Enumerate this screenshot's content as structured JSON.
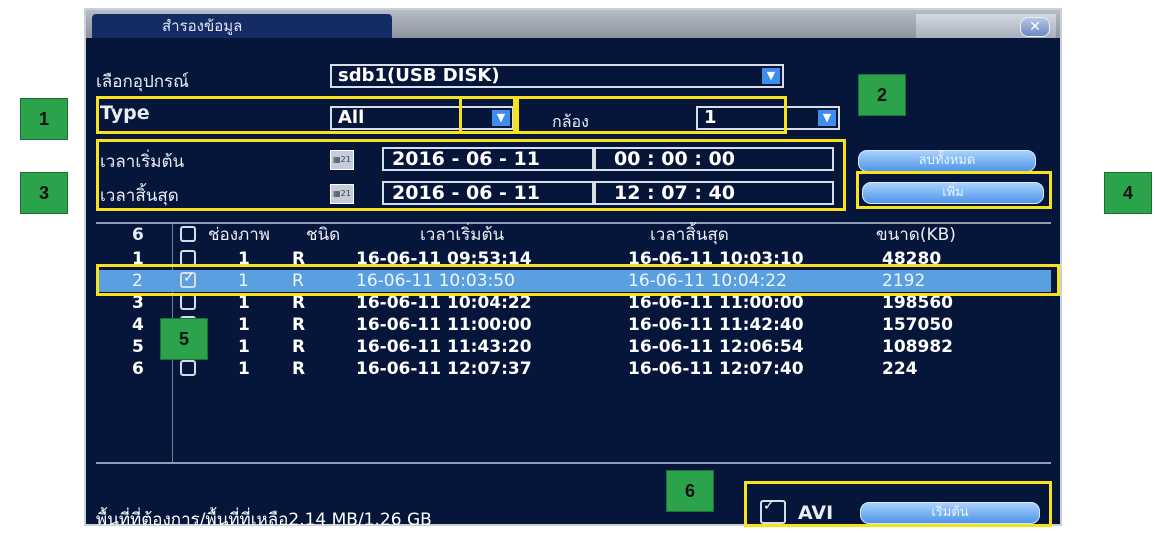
{
  "window": {
    "title": "สำรองข้อมูล"
  },
  "device": {
    "label": "เลือกอุปกรณ์",
    "value": "sdb1(USB DISK)"
  },
  "type": {
    "label": "Type",
    "value": "All"
  },
  "camera": {
    "label": "กล้อง",
    "value": "1"
  },
  "start": {
    "label": "เวลาเริ่มต้น",
    "date": "2016  - 06 - 11",
    "time": "00 : 00 : 00"
  },
  "end": {
    "label": "เวลาสิ้นสุด",
    "date": "2016  - 06 - 11",
    "time": "12 : 07 : 40"
  },
  "buttons": {
    "clear": "ลบทั้งหมด",
    "add": "เพิ่ม",
    "start": "เริ่มต้น"
  },
  "table": {
    "columns": [
      "6",
      "ช่องภาพ",
      "ชนิด",
      "เวลาเริ่มต้น",
      "เวลาสิ้นสุด",
      "ขนาด(KB)"
    ],
    "rows": [
      {
        "no": "1",
        "checked": false,
        "ch": "1",
        "type": "R",
        "start": "16-06-11 09:53:14",
        "end": "16-06-11 10:03:10",
        "size": "48280"
      },
      {
        "no": "2",
        "checked": true,
        "ch": "1",
        "type": "R",
        "start": "16-06-11 10:03:50",
        "end": "16-06-11 10:04:22",
        "size": "2192"
      },
      {
        "no": "3",
        "checked": false,
        "ch": "1",
        "type": "R",
        "start": "16-06-11 10:04:22",
        "end": "16-06-11 11:00:00",
        "size": "198560"
      },
      {
        "no": "4",
        "checked": false,
        "ch": "1",
        "type": "R",
        "start": "16-06-11 11:00:00",
        "end": "16-06-11 11:42:40",
        "size": "157050"
      },
      {
        "no": "5",
        "checked": false,
        "ch": "1",
        "type": "R",
        "start": "16-06-11 11:43:20",
        "end": "16-06-11 12:06:54",
        "size": "108982"
      },
      {
        "no": "6",
        "checked": false,
        "ch": "1",
        "type": "R",
        "start": "16-06-11 12:07:37",
        "end": "16-06-11 12:07:40",
        "size": "224"
      }
    ]
  },
  "footer": {
    "space": "พื้นที่ที่ต้องการ/พื้นที่ที่เหลือ2.14 MB/1.26 GB",
    "avi_label": "AVI"
  },
  "annotations": [
    "1",
    "2",
    "3",
    "4",
    "5",
    "6"
  ],
  "colors": {
    "background": "#06163a",
    "highlight": "#f6e11a",
    "tag": "#2aa34a",
    "selected_row": "#5a9fe0"
  }
}
